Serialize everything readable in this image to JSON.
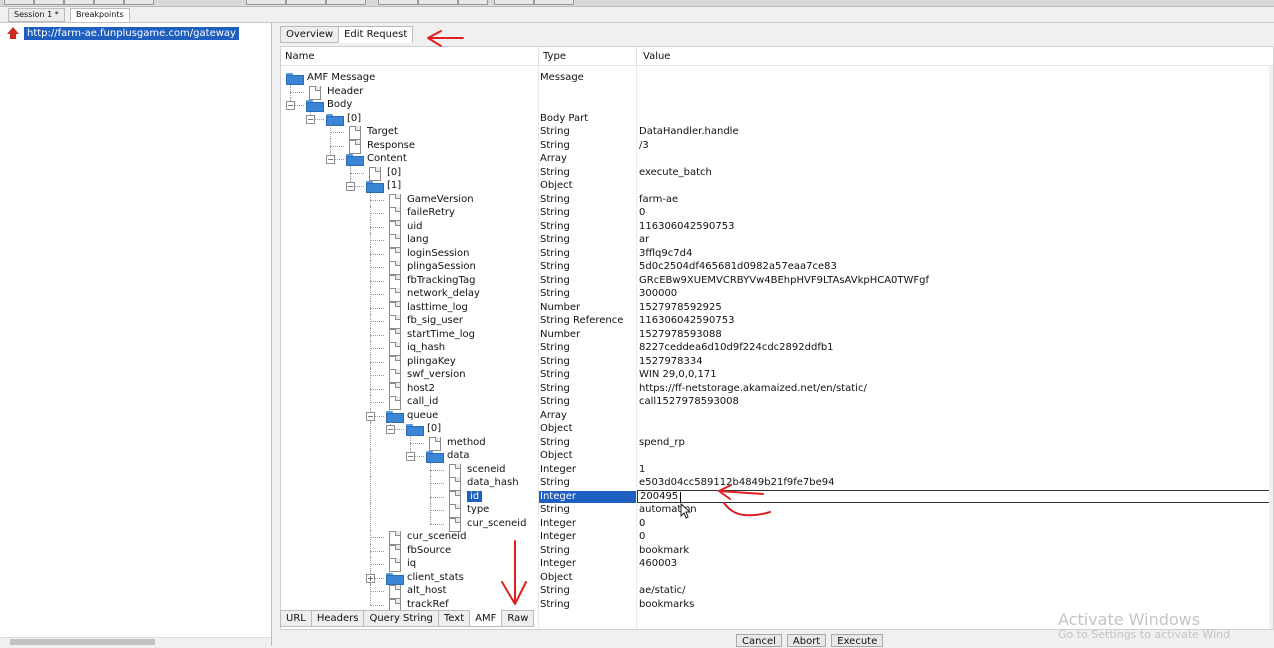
{
  "session_tabs": [
    {
      "label": "Session 1 *",
      "active": false
    },
    {
      "label": "Breakpoints",
      "active": true
    }
  ],
  "session_list": {
    "url": "http://farm-ae.funplusgame.com/gateway"
  },
  "request_tabs": [
    {
      "label": "Overview",
      "active": false
    },
    {
      "label": "Edit Request",
      "active": true
    }
  ],
  "grid": {
    "columns": {
      "name": "Name",
      "type": "Type",
      "value": "Value"
    },
    "rows": [
      {
        "depth": 0,
        "expander": "",
        "icon": "folder",
        "name": "AMF Message",
        "type": "Message",
        "value": ""
      },
      {
        "depth": 1,
        "expander": "",
        "icon": "doc",
        "name": "Header",
        "type": "",
        "value": ""
      },
      {
        "depth": 1,
        "expander": "-",
        "icon": "folder",
        "name": "Body",
        "type": "",
        "value": ""
      },
      {
        "depth": 2,
        "expander": "-",
        "icon": "folder",
        "name": "[0]",
        "type": "Body Part",
        "value": ""
      },
      {
        "depth": 3,
        "expander": "",
        "icon": "doc",
        "name": "Target",
        "type": "String",
        "value": "DataHandler.handle"
      },
      {
        "depth": 3,
        "expander": "",
        "icon": "doc",
        "name": "Response",
        "type": "String",
        "value": "/3"
      },
      {
        "depth": 3,
        "expander": "-",
        "icon": "folder",
        "name": "Content",
        "type": "Array",
        "value": ""
      },
      {
        "depth": 4,
        "expander": "",
        "icon": "doc",
        "name": "[0]",
        "type": "String",
        "value": "execute_batch"
      },
      {
        "depth": 4,
        "expander": "-",
        "icon": "folder",
        "name": "[1]",
        "type": "Object",
        "value": ""
      },
      {
        "depth": 5,
        "expander": "",
        "icon": "doc",
        "name": "GameVersion",
        "type": "String",
        "value": "farm-ae"
      },
      {
        "depth": 5,
        "expander": "",
        "icon": "doc",
        "name": "faileRetry",
        "type": "String",
        "value": "0"
      },
      {
        "depth": 5,
        "expander": "",
        "icon": "doc",
        "name": "uid",
        "type": "String",
        "value": "116306042590753"
      },
      {
        "depth": 5,
        "expander": "",
        "icon": "doc",
        "name": "lang",
        "type": "String",
        "value": "ar"
      },
      {
        "depth": 5,
        "expander": "",
        "icon": "doc",
        "name": "loginSession",
        "type": "String",
        "value": "3fflq9c7d4"
      },
      {
        "depth": 5,
        "expander": "",
        "icon": "doc",
        "name": "plingaSession",
        "type": "String",
        "value": "5d0c2504df465681d0982a57eaa7ce83"
      },
      {
        "depth": 5,
        "expander": "",
        "icon": "doc",
        "name": "fbTrackingTag",
        "type": "String",
        "value": "GRcEBw9XUEMVCRBYVw4BEhpHVF9LTAsAVkpHCA0TWFgf"
      },
      {
        "depth": 5,
        "expander": "",
        "icon": "doc",
        "name": "network_delay",
        "type": "String",
        "value": "300000"
      },
      {
        "depth": 5,
        "expander": "",
        "icon": "doc",
        "name": "lasttime_log",
        "type": "Number",
        "value": "1527978592925"
      },
      {
        "depth": 5,
        "expander": "",
        "icon": "doc",
        "name": "fb_sig_user",
        "type": "String Reference",
        "value": "116306042590753"
      },
      {
        "depth": 5,
        "expander": "",
        "icon": "doc",
        "name": "startTime_log",
        "type": "Number",
        "value": "1527978593088"
      },
      {
        "depth": 5,
        "expander": "",
        "icon": "doc",
        "name": "iq_hash",
        "type": "String",
        "value": "8227ceddea6d10d9f224cdc2892ddfb1"
      },
      {
        "depth": 5,
        "expander": "",
        "icon": "doc",
        "name": "plingaKey",
        "type": "String",
        "value": "1527978334"
      },
      {
        "depth": 5,
        "expander": "",
        "icon": "doc",
        "name": "swf_version",
        "type": "String",
        "value": "WIN 29,0,0,171"
      },
      {
        "depth": 5,
        "expander": "",
        "icon": "doc",
        "name": "host2",
        "type": "String",
        "value": "https://ff-netstorage.akamaized.net/en/static/"
      },
      {
        "depth": 5,
        "expander": "",
        "icon": "doc",
        "name": "call_id",
        "type": "String",
        "value": "call1527978593008"
      },
      {
        "depth": 5,
        "expander": "-",
        "icon": "folder",
        "name": "queue",
        "type": "Array",
        "value": ""
      },
      {
        "depth": 6,
        "expander": "-",
        "icon": "folder",
        "name": "[0]",
        "type": "Object",
        "value": ""
      },
      {
        "depth": 7,
        "expander": "",
        "icon": "doc",
        "name": "method",
        "type": "String",
        "value": "spend_rp"
      },
      {
        "depth": 7,
        "expander": "-",
        "icon": "folder",
        "name": "data",
        "type": "Object",
        "value": ""
      },
      {
        "depth": 8,
        "expander": "",
        "icon": "doc",
        "name": "sceneid",
        "type": "Integer",
        "value": "1"
      },
      {
        "depth": 8,
        "expander": "",
        "icon": "doc",
        "name": "data_hash",
        "type": "String",
        "value": "e503d04cc589112b4849b21f9fe7be94"
      },
      {
        "depth": 8,
        "expander": "",
        "icon": "doc",
        "name": "id",
        "type": "Integer",
        "value": "200495",
        "selected": true
      },
      {
        "depth": 8,
        "expander": "",
        "icon": "doc",
        "name": "type",
        "type": "String",
        "value": "automation"
      },
      {
        "depth": 8,
        "expander": "",
        "icon": "doc",
        "name": "cur_sceneid",
        "type": "Integer",
        "value": "0"
      },
      {
        "depth": 5,
        "expander": "",
        "icon": "doc",
        "name": "cur_sceneid",
        "type": "Integer",
        "value": "0"
      },
      {
        "depth": 5,
        "expander": "",
        "icon": "doc",
        "name": "fbSource",
        "type": "String",
        "value": "bookmark"
      },
      {
        "depth": 5,
        "expander": "",
        "icon": "doc",
        "name": "iq",
        "type": "Integer",
        "value": "460003"
      },
      {
        "depth": 5,
        "expander": "+",
        "icon": "folder",
        "name": "client_stats",
        "type": "Object",
        "value": ""
      },
      {
        "depth": 5,
        "expander": "",
        "icon": "doc",
        "name": "alt_host",
        "type": "String",
        "value": "ae/static/"
      },
      {
        "depth": 5,
        "expander": "",
        "icon": "doc",
        "name": "trackRef",
        "type": "String",
        "value": "bookmarks"
      }
    ]
  },
  "view_tabs": [
    {
      "label": "URL",
      "active": false
    },
    {
      "label": "Headers",
      "active": false
    },
    {
      "label": "Query String",
      "active": false
    },
    {
      "label": "Text",
      "active": false
    },
    {
      "label": "AMF",
      "active": true
    },
    {
      "label": "Raw",
      "active": false
    }
  ],
  "buttons": {
    "cancel": "Cancel",
    "abort": "Abort",
    "execute": "Execute"
  },
  "watermark": {
    "title": "Activate Windows",
    "subtitle": "Go to Settings to activate Wind"
  },
  "colors": {
    "selection": "#1f5fbf",
    "annotation": "#e02020"
  }
}
